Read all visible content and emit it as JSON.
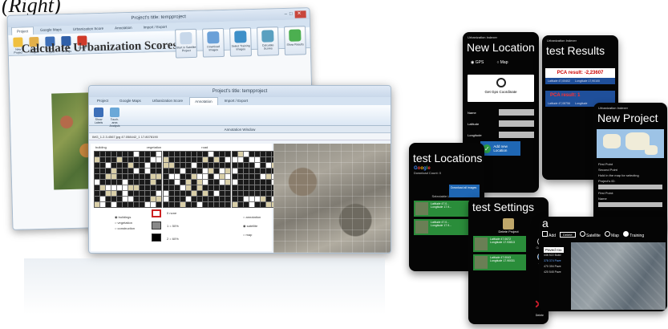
{
  "caption": "(Right)",
  "desktop_main": {
    "window_title": "Project's title: tempproject",
    "tabs": [
      "Project",
      "Google Maps",
      "Urbanization Score",
      "Annotation",
      "Import / Export"
    ],
    "ribbon_buttons": [
      "New Project",
      "Open Project",
      "Save Project",
      "Project Settings",
      "Delete"
    ],
    "heading": "Calculate Urbanization Scores",
    "action_buttons": [
      "Start in Satellite Project",
      "Download Images",
      "Select Training Images",
      "Calculate Scores",
      "Show Results"
    ]
  },
  "desktop_annotation": {
    "window_title": "Project's title: tempproject",
    "tabs": [
      "Project",
      "Google Maps",
      "Urbanization Score",
      "Annotation",
      "Import / Export"
    ],
    "ribbon_buttons": [
      "Show Labels",
      "Touch-area Analysis"
    ],
    "panel_title": "Annotation Window",
    "image_select": "IMG_1.2.3.4567.jpg 47.058442_1 17.8078190",
    "grid_labels": [
      "building",
      "vegetation",
      "road"
    ],
    "legend": [
      "buildings",
      "vegetation",
      "construction"
    ],
    "swatch_labels": [
      "0 none",
      "1 = 50%",
      "2 = 60%"
    ],
    "view_options": [
      "annotation",
      "satellite",
      "map"
    ]
  },
  "phone_new_location": {
    "app": "Urbanization Indexer",
    "title": "New Location",
    "radio_gps": "GPS",
    "radio_map": "Map",
    "gps_button": "Get Gps Coordinate",
    "fields": [
      "Name",
      "Latitude",
      "Longitude"
    ],
    "add_button": "Add new Location"
  },
  "phone_test_results": {
    "app": "Urbanization Indexer",
    "title": "test Results",
    "result": "PCA result: -2,23607",
    "latitude": "Latitude 47,00402",
    "longitude": "Longitude 17,90100",
    "result2": "PCA result: 1",
    "latitude2": "Latitude 47,08756",
    "longitude2": "Longitude"
  },
  "phone_new_project": {
    "app": "Urbanization Indexer",
    "title": "New Project",
    "lines": [
      "First Point",
      "Second Point",
      "Hold in the map for selecting",
      "Project's ID:",
      "First Point:",
      "Name"
    ]
  },
  "phone_test_locations": {
    "title": "test Locations",
    "google": "Google",
    "download_count": "Download Count: 0",
    "download_button": "Download all images",
    "section": "Selectable Locations",
    "rows": [
      {
        "lat": "Latitude 47.0...",
        "lon": "Longitude 17.9..."
      },
      {
        "lat": "Latitude 47.0...",
        "lon": "Longitude 17.9..."
      }
    ]
  },
  "phone_test_settings": {
    "title": "test Settings",
    "delete_project": "Delete Project",
    "rows": [
      {
        "lat": "Latitude 47.0672",
        "lon": "Longitude 17.93813"
      },
      {
        "lat": "Latitude 47.0043",
        "lon": "Longitude 17.90031"
      }
    ],
    "side_buttons": [
      "Go to M",
      "Add"
    ],
    "delete": "Delete"
  },
  "phone_landscape": {
    "title": "a",
    "add_label": "Add",
    "delete_button": "Delete",
    "options": [
      "Satellite",
      "Map",
      "Training"
    ],
    "list": [
      "Paved rou",
      "446 522 Build",
      "378 374 Pave",
      "470 394 Pave",
      "420 545 Pave"
    ]
  }
}
